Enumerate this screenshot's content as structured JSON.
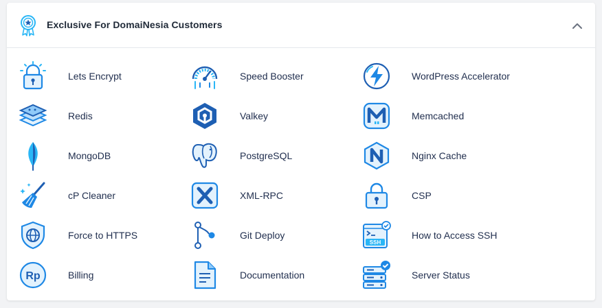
{
  "header": {
    "title": "Exclusive For DomaiNesia Customers",
    "icon": "award-badge-icon",
    "collapse_icon": "chevron-up-icon"
  },
  "colors": {
    "accent": "#1e88e5",
    "accent_light": "#29b6f6",
    "text": "#1f2d4d",
    "header_text": "#1f2937"
  },
  "items": [
    {
      "label": "Lets Encrypt",
      "icon": "lets-encrypt-lock-icon"
    },
    {
      "label": "Speed Booster",
      "icon": "speedometer-icon"
    },
    {
      "label": "WordPress Accelerator",
      "icon": "lightning-bolt-icon"
    },
    {
      "label": "Redis",
      "icon": "redis-stack-icon"
    },
    {
      "label": "Valkey",
      "icon": "valkey-hexagon-icon"
    },
    {
      "label": "Memcached",
      "icon": "memcached-m-icon"
    },
    {
      "label": "MongoDB",
      "icon": "mongodb-leaf-icon"
    },
    {
      "label": "PostgreSQL",
      "icon": "postgresql-elephant-icon"
    },
    {
      "label": "Nginx Cache",
      "icon": "nginx-n-icon"
    },
    {
      "label": "cP Cleaner",
      "icon": "broom-icon"
    },
    {
      "label": "XML-RPC",
      "icon": "xml-rpc-x-icon"
    },
    {
      "label": "CSP",
      "icon": "padlock-icon"
    },
    {
      "label": "Force to HTTPS",
      "icon": "shield-globe-icon"
    },
    {
      "label": "Git Deploy",
      "icon": "git-branch-icon"
    },
    {
      "label": "How to Access SSH",
      "icon": "ssh-terminal-icon"
    },
    {
      "label": "Billing",
      "icon": "rupiah-billing-icon"
    },
    {
      "label": "Documentation",
      "icon": "document-icon"
    },
    {
      "label": "Server Status",
      "icon": "server-check-icon"
    }
  ]
}
